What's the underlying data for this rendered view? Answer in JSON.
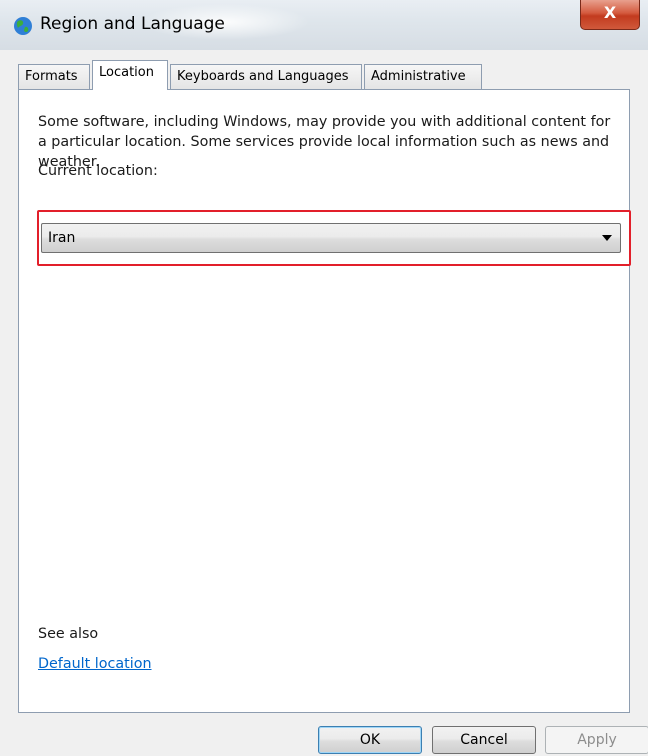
{
  "window": {
    "title": "Region and Language",
    "close_label": "X"
  },
  "tabs": [
    {
      "label": "Formats"
    },
    {
      "label": "Location"
    },
    {
      "label": "Keyboards and Languages"
    },
    {
      "label": "Administrative"
    }
  ],
  "location_page": {
    "description": "Some software, including Windows, may provide you with additional content for a particular location. Some services provide local information such as news and weather.",
    "current_location_label": "Current location:",
    "current_location_value": "Iran",
    "see_also_label": "See also",
    "default_location_link": "Default location"
  },
  "buttons": {
    "ok": "OK",
    "cancel": "Cancel",
    "apply": "Apply"
  },
  "colors": {
    "highlight": "#e21f2a",
    "link": "#0066cc"
  }
}
